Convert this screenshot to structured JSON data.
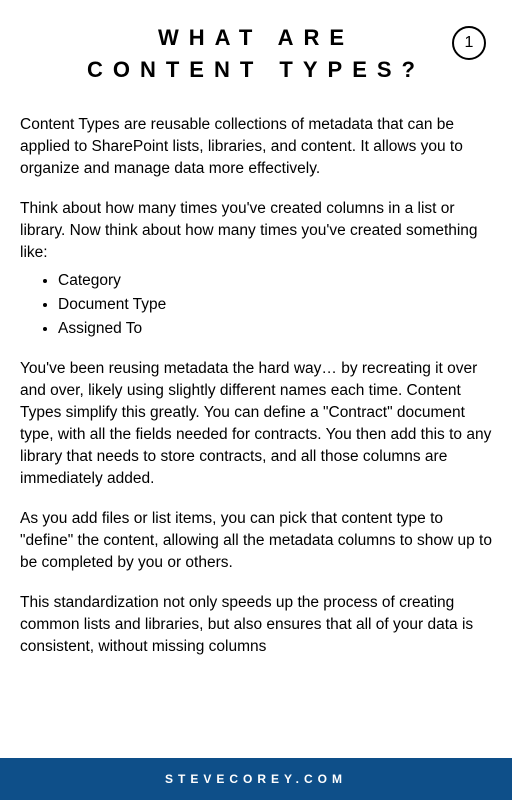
{
  "header": {
    "title": "WHAT ARE CONTENT TYPES?",
    "page_number": "1"
  },
  "body": {
    "para1": "Content Types are reusable collections of metadata that can be applied to SharePoint lists, libraries, and content. It allows you to organize and manage data more effectively.",
    "para2": "Think about how many times you've created columns in a list or library. Now think about how many times you've created something like:",
    "list": [
      "Category",
      "Document Type",
      "Assigned To"
    ],
    "para3": "You've been reusing metadata the hard way… by recreating it over and over, likely using slightly different names each time. Content Types simplify this greatly. You can define a \"Contract\" document type, with all the fields needed for contracts. You then add this to any library that needs to store contracts, and all those columns are immediately added.",
    "para4": "As you add files or list items, you can pick that content type to \"define\" the content, allowing all the metadata columns to show up to be completed by you or others.",
    "para5": "This standardization not only speeds up the process of creating common lists and libraries, but also ensures that all of your data is consistent, without missing columns"
  },
  "footer": {
    "site": "STEVECOREY.COM"
  }
}
